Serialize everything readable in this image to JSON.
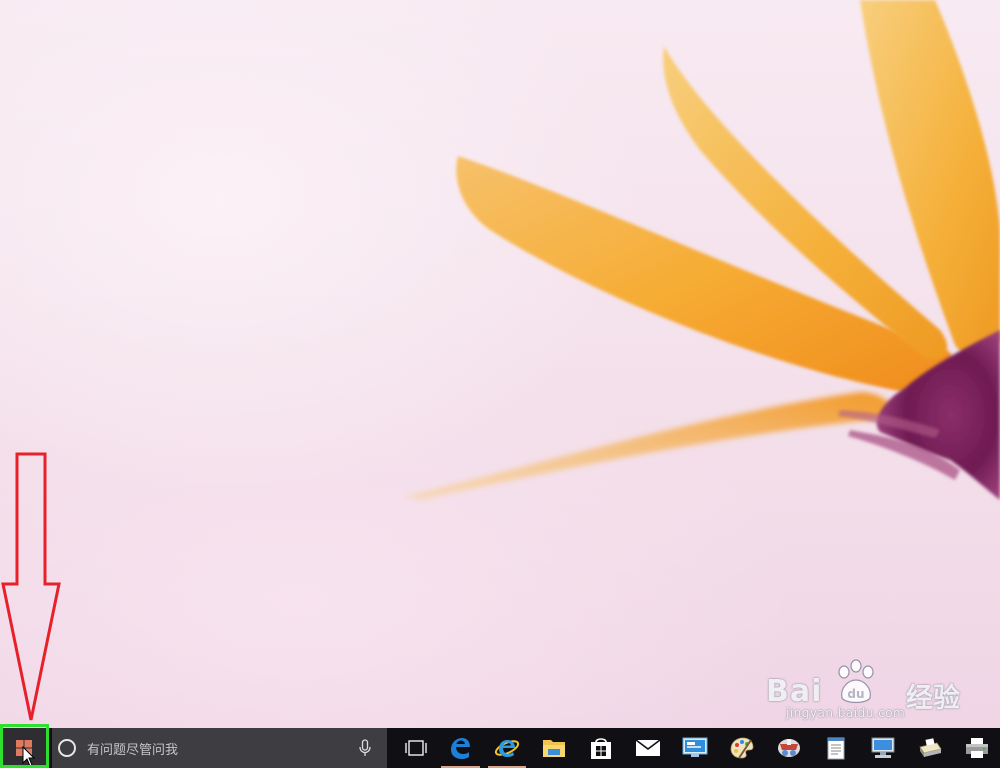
{
  "desktop": {
    "wallpaper": "pink-background-orange-flower",
    "colors": {
      "background": "#f6e4ee",
      "petal": "#f5a428",
      "flower_center": "#7b1f5c"
    }
  },
  "annotation": {
    "arrow": "red-down-arrow",
    "highlight": "start-button-green-box",
    "colors": {
      "arrow": "#e8202a",
      "highlight": "#2ee02e"
    }
  },
  "watermark": {
    "brand_text": "Bai",
    "brand_suffix": "经验",
    "url": "jingyan.baidu.com"
  },
  "taskbar": {
    "start_icon": "windows-logo-icon",
    "search": {
      "placeholder": "有问题尽管问我",
      "icon": "cortana-icon",
      "mic_icon": "microphone-icon"
    },
    "task_view_icon": "task-view-icon",
    "apps": [
      {
        "name": "edge-icon",
        "active": true
      },
      {
        "name": "internet-explorer-icon",
        "active": true
      },
      {
        "name": "file-explorer-icon",
        "active": false
      },
      {
        "name": "store-icon",
        "active": false
      },
      {
        "name": "mail-icon",
        "active": false
      },
      {
        "name": "remote-desktop-icon",
        "active": false
      },
      {
        "name": "paint-icon",
        "active": false
      },
      {
        "name": "character-map-icon",
        "active": false
      },
      {
        "name": "notepad-icon",
        "active": false
      },
      {
        "name": "computer-icon",
        "active": false
      },
      {
        "name": "scanner-icon",
        "active": false
      },
      {
        "name": "printer-icon",
        "active": false
      }
    ],
    "colors": {
      "background": "#101014",
      "search_background": "#3d3d42"
    }
  }
}
